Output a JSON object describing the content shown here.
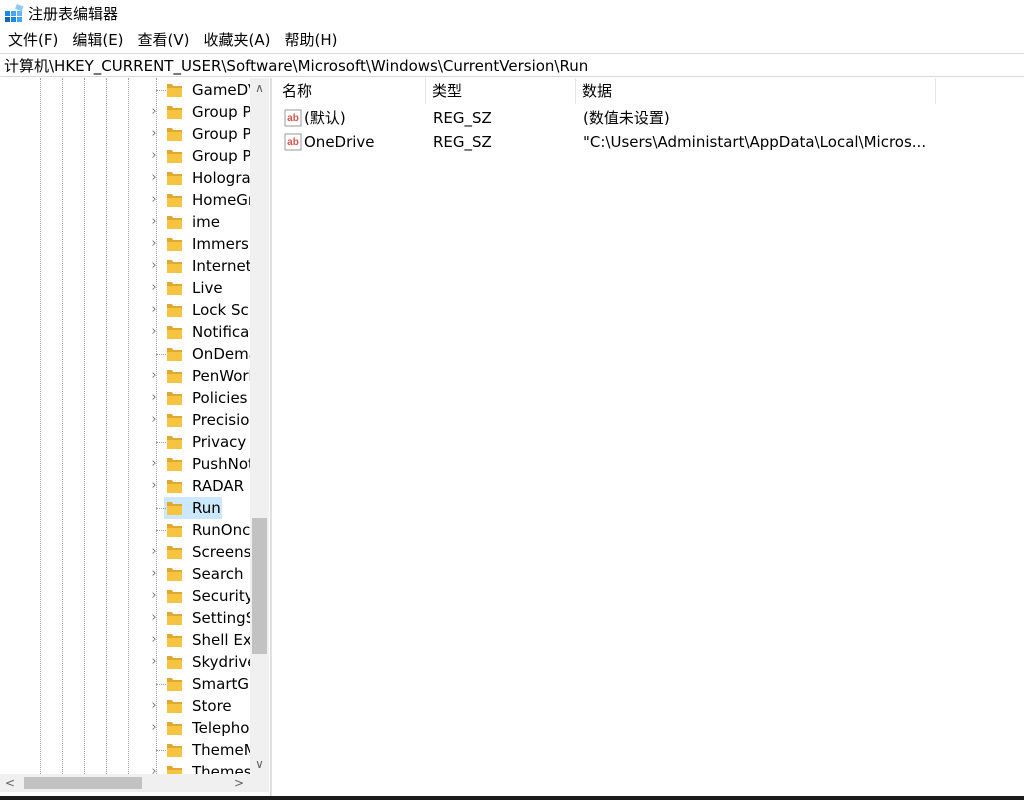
{
  "window": {
    "title": "注册表编辑器",
    "icon": "registry-editor-icon"
  },
  "menu": [
    {
      "label": "文件(F)"
    },
    {
      "label": "编辑(E)"
    },
    {
      "label": "查看(V)"
    },
    {
      "label": "收藏夹(A)"
    },
    {
      "label": "帮助(H)"
    }
  ],
  "address": {
    "path": "计算机\\HKEY_CURRENT_USER\\Software\\Microsoft\\Windows\\CurrentVersion\\Run"
  },
  "tree": {
    "items": [
      {
        "label": "GameDVR",
        "expandable": false,
        "selected": false
      },
      {
        "label": "Group Policy Editor",
        "expandable": true,
        "selected": false
      },
      {
        "label": "Group Policy Objects",
        "expandable": true,
        "selected": false
      },
      {
        "label": "Group Policy",
        "expandable": true,
        "selected": false
      },
      {
        "label": "Holographic",
        "expandable": true,
        "selected": false
      },
      {
        "label": "HomeGroup",
        "expandable": true,
        "selected": false
      },
      {
        "label": "ime",
        "expandable": true,
        "selected": false
      },
      {
        "label": "ImmersiveShell",
        "expandable": true,
        "selected": false
      },
      {
        "label": "Internet Settings",
        "expandable": true,
        "selected": false
      },
      {
        "label": "Live",
        "expandable": true,
        "selected": false
      },
      {
        "label": "Lock Screen",
        "expandable": true,
        "selected": false
      },
      {
        "label": "Notifications",
        "expandable": true,
        "selected": false
      },
      {
        "label": "OnDemandInterfaceCache",
        "expandable": false,
        "selected": false
      },
      {
        "label": "PenWorkspace",
        "expandable": true,
        "selected": false
      },
      {
        "label": "Policies",
        "expandable": true,
        "selected": false
      },
      {
        "label": "PrecisionTouchPad",
        "expandable": true,
        "selected": false
      },
      {
        "label": "Privacy",
        "expandable": false,
        "selected": false
      },
      {
        "label": "PushNotifications",
        "expandable": true,
        "selected": false
      },
      {
        "label": "RADAR",
        "expandable": true,
        "selected": false
      },
      {
        "label": "Run",
        "expandable": false,
        "selected": true
      },
      {
        "label": "RunOnce",
        "expandable": false,
        "selected": false
      },
      {
        "label": "Screensavers",
        "expandable": true,
        "selected": false
      },
      {
        "label": "Search",
        "expandable": true,
        "selected": false
      },
      {
        "label": "Security and Maintenance",
        "expandable": true,
        "selected": false
      },
      {
        "label": "SettingSync",
        "expandable": true,
        "selected": false
      },
      {
        "label": "Shell Extensions",
        "expandable": true,
        "selected": false
      },
      {
        "label": "Skydrive",
        "expandable": true,
        "selected": false
      },
      {
        "label": "SmartGlass",
        "expandable": false,
        "selected": false
      },
      {
        "label": "Store",
        "expandable": true,
        "selected": false
      },
      {
        "label": "Telephony",
        "expandable": true,
        "selected": false
      },
      {
        "label": "ThemeManager",
        "expandable": false,
        "selected": false
      },
      {
        "label": "Themes",
        "expandable": true,
        "selected": false
      }
    ]
  },
  "list": {
    "columns": {
      "name": "名称",
      "type": "类型",
      "data": "数据"
    },
    "rows": [
      {
        "name": "(默认)",
        "type": "REG_SZ",
        "data": "(数值未设置)",
        "icon": "string-value-icon"
      },
      {
        "name": "OneDrive",
        "type": "REG_SZ",
        "data": "\"C:\\Users\\Administart\\AppData\\Local\\Micros...",
        "icon": "string-value-icon"
      }
    ]
  },
  "colors": {
    "selection": "#cce8ff",
    "folder": "#f5c542",
    "string_icon": "#d9534f"
  }
}
